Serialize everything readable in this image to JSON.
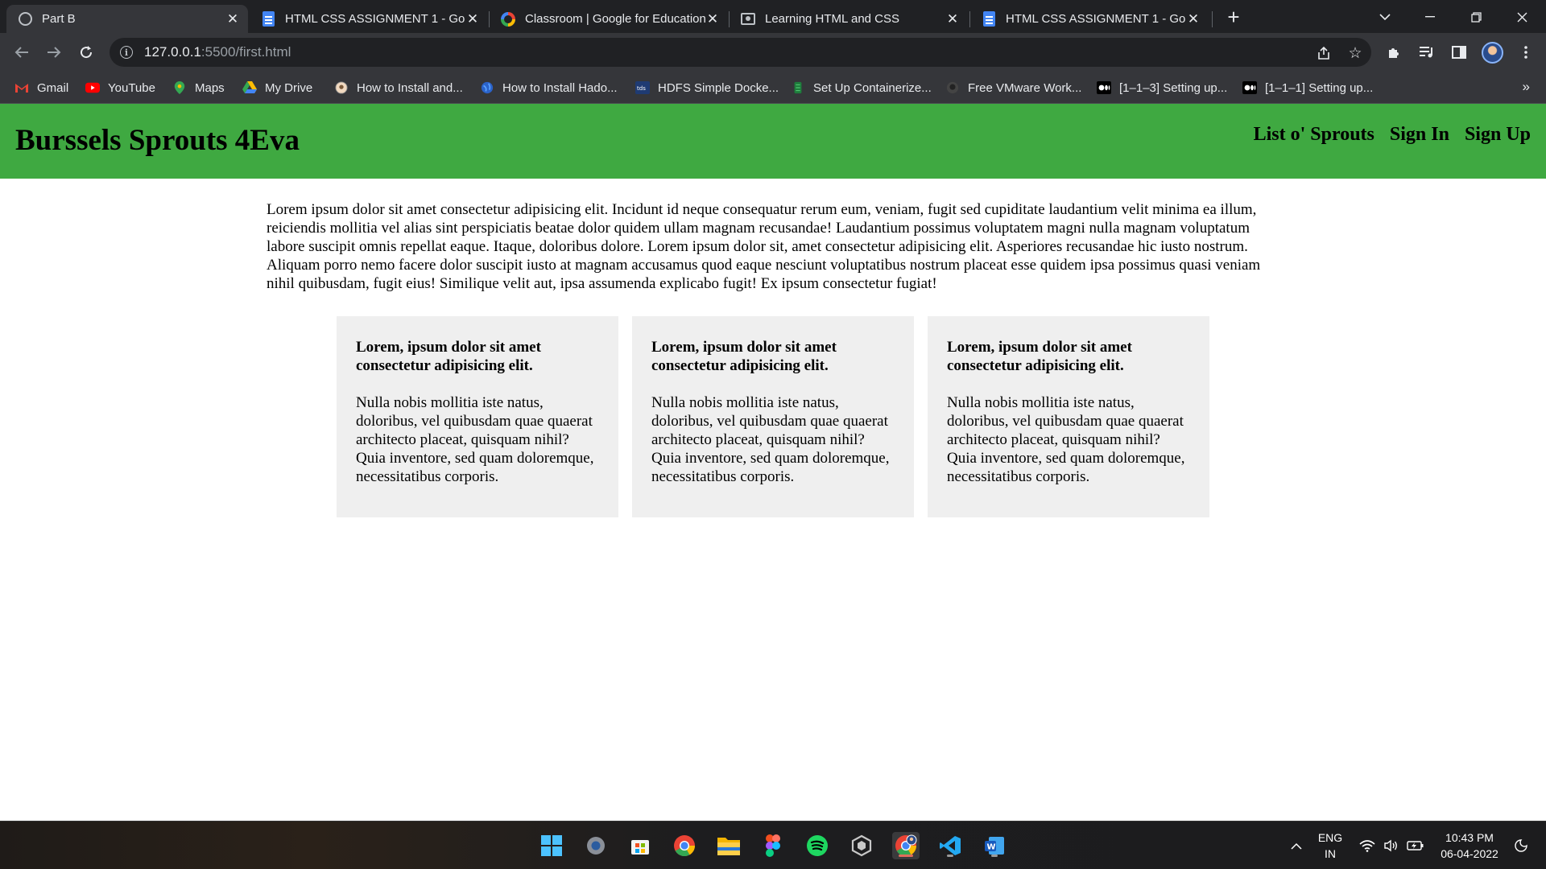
{
  "browser": {
    "tabs": [
      {
        "title": "Part B",
        "active": true,
        "favicon": "globe-icon"
      },
      {
        "title": "HTML CSS ASSIGNMENT 1 - Goo",
        "active": false,
        "favicon": "docs-icon"
      },
      {
        "title": "Classroom | Google for Education",
        "active": false,
        "favicon": "google-icon"
      },
      {
        "title": "Learning HTML and CSS",
        "active": false,
        "favicon": "classroom-icon"
      },
      {
        "title": "HTML CSS ASSIGNMENT 1 - Goo",
        "active": false,
        "favicon": "docs-icon"
      }
    ],
    "close_glyph": "✕",
    "new_tab_glyph": "+",
    "url_host": "127.0.0.1",
    "url_rest": ":5500/first.html",
    "bookmarks": [
      {
        "label": "Gmail",
        "icon": "gmail-icon"
      },
      {
        "label": "YouTube",
        "icon": "youtube-icon"
      },
      {
        "label": "Maps",
        "icon": "maps-icon"
      },
      {
        "label": "My Drive",
        "icon": "drive-icon"
      },
      {
        "label": "How to Install and...",
        "icon": "site-icon"
      },
      {
        "label": "How to Install Hado...",
        "icon": "globe-icon"
      },
      {
        "label": "HDFS Simple Docke...",
        "icon": "site-icon"
      },
      {
        "label": "Set Up Containerize...",
        "icon": "site-icon"
      },
      {
        "label": "Free VMware Work...",
        "icon": "github-icon"
      },
      {
        "label": "[1–1–3] Setting up...",
        "icon": "medium-icon"
      },
      {
        "label": "[1–1–1] Setting up...",
        "icon": "medium-icon"
      }
    ],
    "bookmarks_more": "»"
  },
  "page": {
    "site_title": "Burssels Sprouts 4Eva",
    "nav": [
      "List o' Sprouts",
      "Sign In",
      "Sign Up"
    ],
    "intro": "Lorem ipsum dolor sit amet consectetur adipisicing elit. Incidunt id neque consequatur rerum eum, veniam, fugit sed cupiditate laudantium velit minima ea illum, reiciendis mollitia vel alias sint perspiciatis beatae dolor quidem ullam magnam recusandae! Laudantium possimus voluptatem magni nulla magnam voluptatum labore suscipit omnis repellat eaque. Itaque, doloribus dolore. Lorem ipsum dolor sit, amet consectetur adipisicing elit. Asperiores recusandae hic iusto nostrum. Aliquam porro nemo facere dolor suscipit iusto at magnam accusamus quod eaque nesciunt voluptatibus nostrum placeat esse quidem ipsa possimus quasi veniam nihil quibusdam, fugit eius! Similique velit aut, ipsa assumenda explicabo fugit! Ex ipsum consectetur fugiat!",
    "cards": [
      {
        "heading": "Lorem, ipsum dolor sit amet consectetur adipisicing elit.",
        "body": "Nulla nobis mollitia iste natus, doloribus, vel quibusdam quae quaerat architecto placeat, quisquam nihil? Quia inventore, sed quam doloremque, necessitatibus corporis."
      },
      {
        "heading": "Lorem, ipsum dolor sit amet consectetur adipisicing elit.",
        "body": "Nulla nobis mollitia iste natus, doloribus, vel quibusdam quae quaerat architecto placeat, quisquam nihil? Quia inventore, sed quam doloremque, necessitatibus corporis."
      },
      {
        "heading": "Lorem, ipsum dolor sit amet consectetur adipisicing elit.",
        "body": "Nulla nobis mollitia iste natus, doloribus, vel quibusdam quae quaerat architecto placeat, quisquam nihil? Quia inventore, sed quam doloremque, necessitatibus corporis."
      }
    ]
  },
  "taskbar": {
    "apps": [
      "start-icon",
      "settings-icon",
      "store-icon",
      "chrome-icon",
      "file-explorer-icon",
      "figma-icon",
      "spotify-icon",
      "unity-icon",
      "chrome-profile-icon",
      "vscode-icon",
      "word-icon"
    ],
    "lang_primary": "ENG",
    "lang_secondary": "IN",
    "time": "10:43 PM",
    "date": "06-04-2022"
  },
  "colors": {
    "site_header": "#3fa941",
    "card_bg": "#efefef",
    "browser_dark": "#202124"
  }
}
